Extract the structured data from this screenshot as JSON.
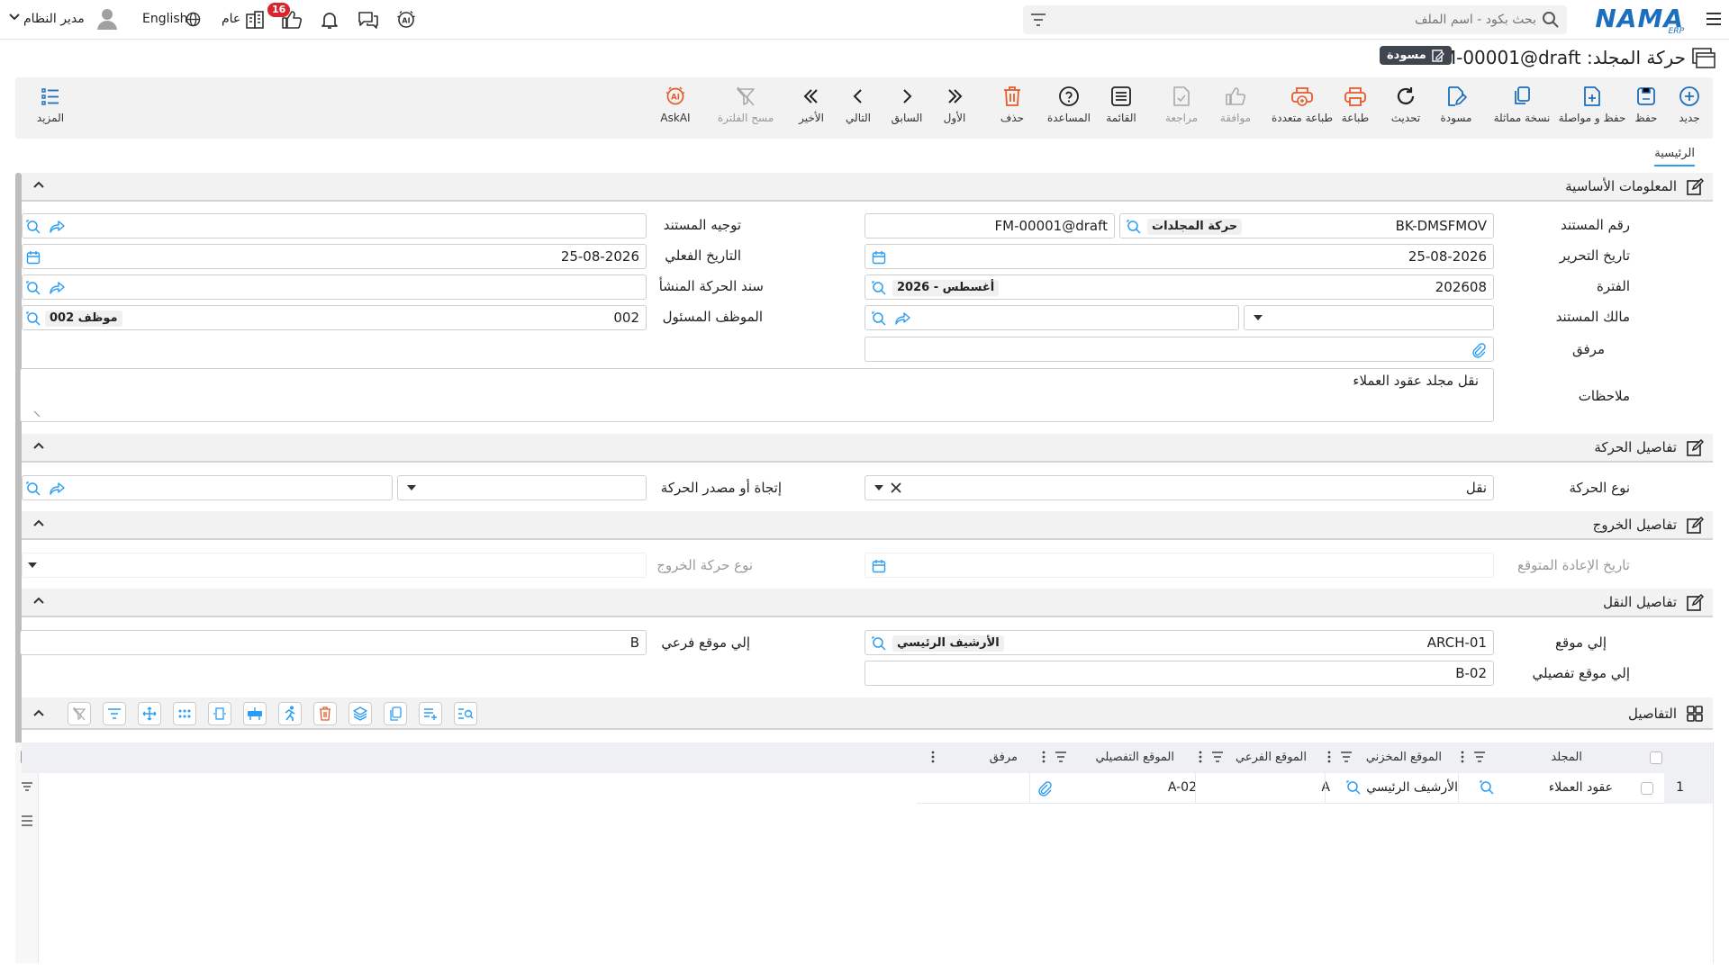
{
  "topbar": {
    "logo_text": "NAMA",
    "logo_sub": "ERP",
    "search_placeholder": "بحث بكود - اسم الملف",
    "user_name": "مدير النظام",
    "language": "English",
    "scope": "عام",
    "notifications_count": "16"
  },
  "title": {
    "text": "حركة المجلد: FM-00001@draft",
    "status": "مسودة"
  },
  "toolbar": {
    "new": "جديد",
    "save": "حفظ",
    "save_continue": "حفظ و مواصلة",
    "duplicate": "نسخة مماثلة",
    "draft": "مسودة",
    "refresh": "تحديث",
    "print": "طباعة",
    "multi_print": "طباعة متعددة",
    "approve": "موافقة",
    "review": "مراجعة",
    "list": "القائمة",
    "help": "المساعدة",
    "delete": "حذف",
    "first": "الأول",
    "prev": "السابق",
    "next": "التالي",
    "last": "الأخير",
    "clear_filter": "مسح الفلترة",
    "askai": "AskAI",
    "more": "المزيد"
  },
  "tabs": {
    "main": "الرئيسية"
  },
  "sections": {
    "basic": "المعلومات الأساسية",
    "movement": "تفاصيل الحركة",
    "exit": "تفاصيل الخروج",
    "transfer": "تفاصيل النقل",
    "details": "التفاصيل"
  },
  "fields": {
    "doc_number": {
      "label": "رقم المستند",
      "value": "BK-DMSFMOV",
      "chip": "حركة المجلدات",
      "code": "FM-00001@draft"
    },
    "doc_direction": {
      "label": "توجيه المستند",
      "value": ""
    },
    "edit_date": {
      "label": "تاريخ التحرير",
      "value": "25-08-2026"
    },
    "actual_date": {
      "label": "التاريخ الفعلي",
      "value": "25-08-2026"
    },
    "period": {
      "label": "الفترة",
      "value": "202608",
      "chip": "2026 - أغسطس"
    },
    "origin_doc": {
      "label": "سند الحركة المنشأ",
      "value": ""
    },
    "doc_owner": {
      "label": "مالك المستند",
      "value": ""
    },
    "responsible": {
      "label": "الموظف المسئول",
      "value": "002",
      "chip": "موظف 002"
    },
    "attachment": {
      "label": "مرفق",
      "value": ""
    },
    "notes": {
      "label": "ملاحظات",
      "value": "نقل مجلد عقود العملاء"
    },
    "move_type": {
      "label": "نوع الحركة",
      "value": "نقل"
    },
    "move_direction": {
      "label": "إتجاة أو مصدر الحركة",
      "value": ""
    },
    "expected_return": {
      "label": "تاريخ الإعادة المتوقع",
      "value": ""
    },
    "exit_type": {
      "label": "نوع حركة الخروج",
      "value": ""
    },
    "to_location": {
      "label": "إلي موقع",
      "value": "ARCH-01",
      "chip": "الأرشيف الرئيسي"
    },
    "to_sublocation": {
      "label": "إلي موقع فرعي",
      "value": "B"
    },
    "to_detail_location": {
      "label": "إلي موقع تفصيلي",
      "value": "B-02"
    }
  },
  "grid": {
    "columns": [
      "المجلد",
      "الموقع المخزني",
      "الموقع الفرعي",
      "الموقع التفصيلي",
      "مرفق"
    ],
    "rows": [
      {
        "num": "1",
        "folder": "عقود العملاء",
        "store": "الأرشيف الرئيسي",
        "sub": "A",
        "detail": "A-02",
        "attachment": ""
      }
    ]
  },
  "colors": {
    "accent": "#2a9df4",
    "danger": "#d9232d",
    "print": "#e85a2a"
  }
}
